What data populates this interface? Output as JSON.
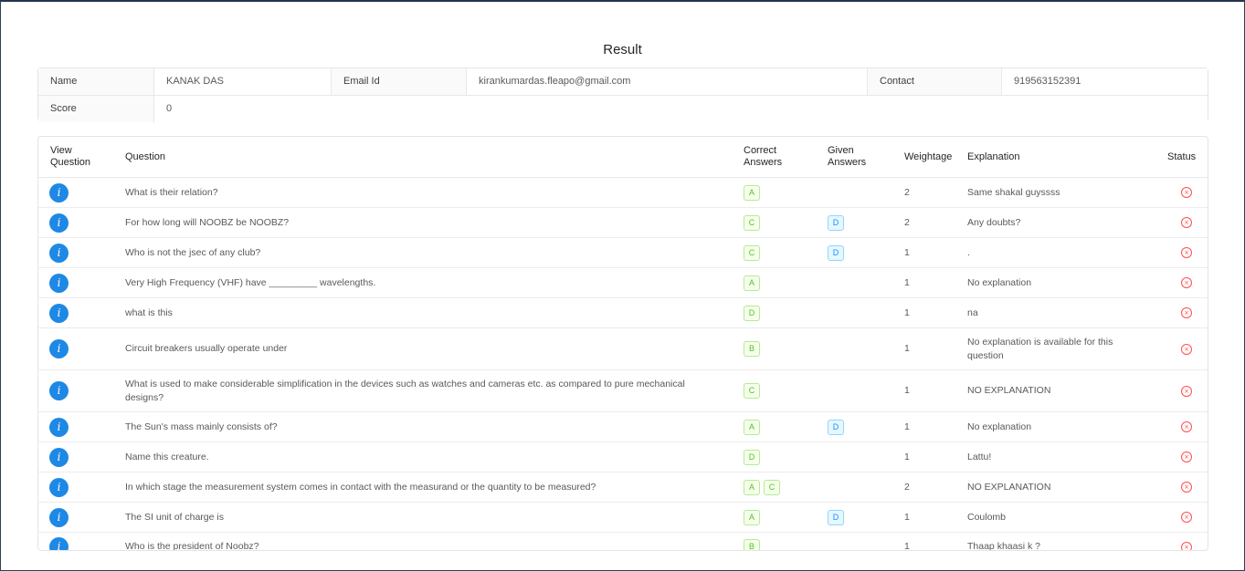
{
  "page": {
    "title": "Result"
  },
  "info": {
    "name_label": "Name",
    "name_value": "KANAK DAS",
    "email_label": "Email Id",
    "email_value": "kirankumardas.fleapo@gmail.com",
    "contact_label": "Contact",
    "contact_value": "919563152391",
    "score_label": "Score",
    "score_value": "0"
  },
  "table": {
    "headers": {
      "view": [
        "View",
        "Question"
      ],
      "question": "Question",
      "correct": [
        "Correct",
        "Answers"
      ],
      "given": [
        "Given",
        "Answers"
      ],
      "weightage": "Weightage",
      "explanation": "Explanation",
      "status": "Status"
    },
    "rows": [
      {
        "question": "What is their relation?",
        "correct": [
          "A"
        ],
        "given": [],
        "weightage": "2",
        "explanation": "Same shakal guyssss"
      },
      {
        "question": "For how long will NOOBZ be NOOBZ?",
        "correct": [
          "C"
        ],
        "given": [
          "D"
        ],
        "weightage": "2",
        "explanation": "Any doubts?"
      },
      {
        "question": "Who is not the jsec of any club?",
        "correct": [
          "C"
        ],
        "given": [
          "D"
        ],
        "weightage": "1",
        "explanation": "."
      },
      {
        "question": "Very High Frequency (VHF) have _________ wavelengths.",
        "correct": [
          "A"
        ],
        "given": [],
        "weightage": "1",
        "explanation": "No explanation"
      },
      {
        "question": "what is this",
        "correct": [
          "D"
        ],
        "given": [],
        "weightage": "1",
        "explanation": "na"
      },
      {
        "question": "Circuit breakers usually operate under",
        "correct": [
          "B"
        ],
        "given": [],
        "weightage": "1",
        "explanation": "No explanation is available for this question"
      },
      {
        "question": "What is used to make considerable simplification in the devices such as watches and cameras etc. as compared to pure mechanical designs?",
        "correct": [
          "C"
        ],
        "given": [],
        "weightage": "1",
        "explanation": "NO EXPLANATION"
      },
      {
        "question": "The Sun's mass mainly consists of?",
        "correct": [
          "A"
        ],
        "given": [
          "D"
        ],
        "weightage": "1",
        "explanation": "No explanation"
      },
      {
        "question": "Name this creature.",
        "correct": [
          "D"
        ],
        "given": [],
        "weightage": "1",
        "explanation": "Lattu!"
      },
      {
        "question": "In which stage the measurement system comes in contact with the measurand or the quantity to be measured?",
        "correct": [
          "A",
          "C"
        ],
        "given": [],
        "weightage": "2",
        "explanation": "NO EXPLANATION"
      },
      {
        "question": "The SI unit of charge is",
        "correct": [
          "A"
        ],
        "given": [
          "D"
        ],
        "weightage": "1",
        "explanation": "Coulomb"
      },
      {
        "question": "Who is the president of Noobz?",
        "correct": [
          "B"
        ],
        "given": [],
        "weightage": "1",
        "explanation": "Thaap khaasi k ?"
      }
    ],
    "info_icon_glyph": "i",
    "status_icon_glyph": "×",
    "status_icon": "close-circle-icon",
    "info_icon": "info-icon"
  },
  "colors": {
    "info_button": "#1e88e5",
    "correct_tag": "#52c41a",
    "given_tag": "#1890ff",
    "status_wrong": "#ff4d4f"
  }
}
